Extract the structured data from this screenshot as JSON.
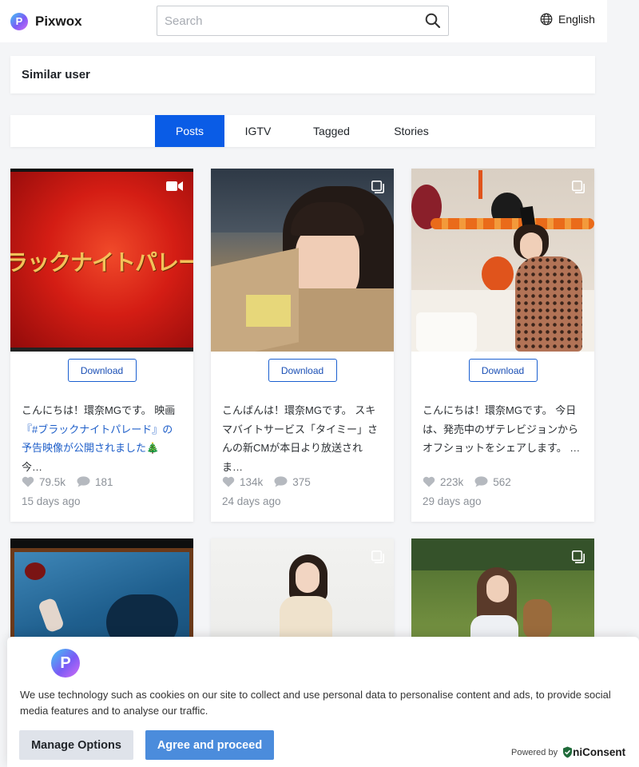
{
  "app": {
    "name": "Pixwox"
  },
  "search": {
    "placeholder": "Search"
  },
  "language": {
    "label": "English"
  },
  "similar": {
    "title": "Similar user"
  },
  "tabs": [
    {
      "label": "Posts",
      "active": true
    },
    {
      "label": "IGTV",
      "active": false
    },
    {
      "label": "Tagged",
      "active": false
    },
    {
      "label": "Stories",
      "active": false
    }
  ],
  "posts": [
    {
      "thumb_overlay": "ラックナイトパレー",
      "type_icon": "video-camera-icon",
      "download_label": "Download",
      "caption_parts": [
        {
          "text": "こんにちは！環奈MGです。 映画"
        },
        {
          "text": "『#ブラックナイトパレード』の予告映像が公開されました",
          "hl": true
        },
        {
          "text": "🎄 今…"
        }
      ],
      "likes": "79.5k",
      "comments": "181",
      "time": "15 days ago"
    },
    {
      "type_icon": "multi-image-icon",
      "download_label": "Download",
      "caption_parts": [
        {
          "text": "こんばんは！環奈MGです。 スキマバイトサービス「タイミー」さんの新CMが本日より放送されま…"
        }
      ],
      "likes": "134k",
      "comments": "375",
      "time": "24 days ago"
    },
    {
      "type_icon": "multi-image-icon",
      "download_label": "Download",
      "caption_parts": [
        {
          "text": "こんにちは！環奈MGです。 今日は、発売中のザテレビジョンからオフショットをシェアします。 …"
        }
      ],
      "likes": "223k",
      "comments": "562",
      "time": "29 days ago"
    },
    {
      "type_icon": ""
    },
    {
      "type_icon": "multi-image-icon"
    },
    {
      "type_icon": "multi-image-icon"
    }
  ],
  "consent": {
    "text": "We use technology such as cookies on our site to collect and use personal data to personalise content and ads, to provide social media features and to analyse our traffic.",
    "manage_label": "Manage Options",
    "agree_label": "Agree and proceed",
    "powered_by": "Powered by",
    "brand": "niConsent"
  },
  "colors": {
    "accent": "#0a5ce6",
    "agree": "#4b8cdc",
    "link": "#1f5fc9"
  }
}
